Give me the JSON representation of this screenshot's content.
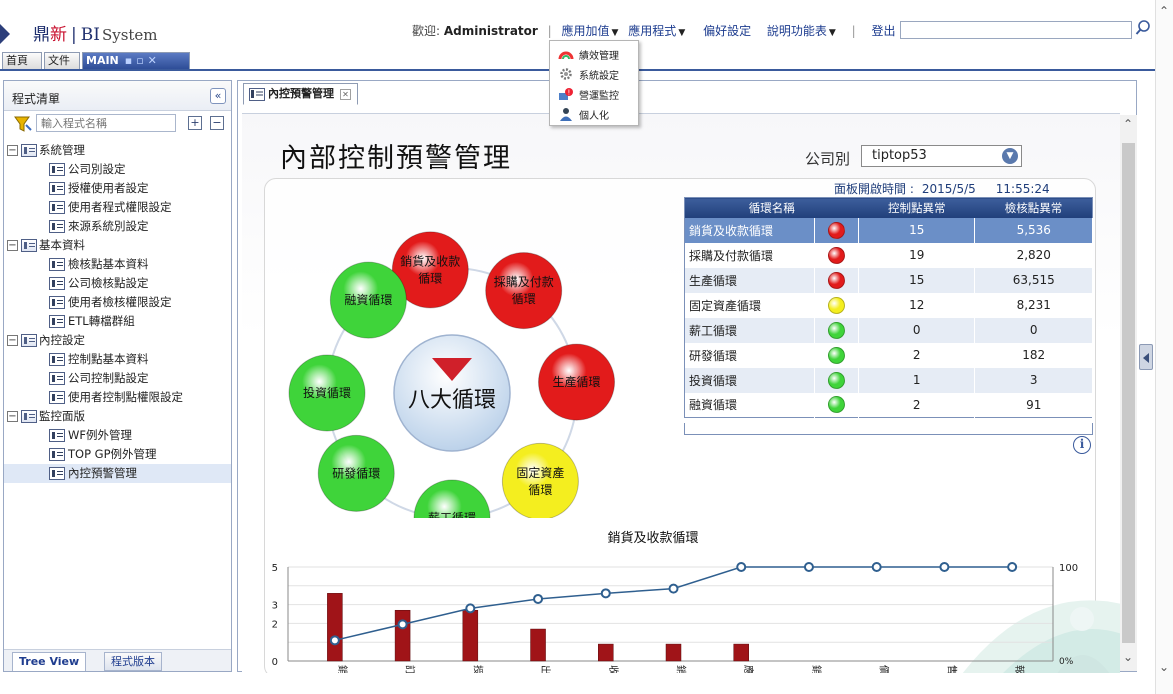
{
  "logo": {
    "part1": "鼎",
    "part2": "新",
    "bar": "|",
    "part3": "BI",
    "part4": "System"
  },
  "topnav": {
    "welcome": "歡迎:",
    "user": "Administrator",
    "sep1": "|",
    "app_addon": "應用加值",
    "app_program": "應用程式",
    "preferences": "偏好設定",
    "help_menu": "說明功能表",
    "sep2": "|",
    "logout": "登出"
  },
  "app_menu": {
    "items": [
      {
        "label": "績效管理",
        "icon": "gauge-icon"
      },
      {
        "label": "系統設定",
        "icon": "gear-icon"
      },
      {
        "label": "營運監控",
        "icon": "monitor-icon"
      },
      {
        "label": "個人化",
        "icon": "user-icon"
      }
    ]
  },
  "tabs": [
    {
      "label": "首頁"
    },
    {
      "label": "文件"
    },
    {
      "label": "MAIN"
    }
  ],
  "left_panel": {
    "title": "程式清單",
    "collapse": "«",
    "search_placeholder": "輸入程式名稱",
    "expand_all": "+",
    "collapse_all": "−",
    "tree": [
      {
        "label": "系統管理",
        "level": 0,
        "folder": true
      },
      {
        "label": "公司別設定",
        "level": 1
      },
      {
        "label": "授權使用者設定",
        "level": 1
      },
      {
        "label": "使用者程式權限設定",
        "level": 1
      },
      {
        "label": "來源系統別設定",
        "level": 1
      },
      {
        "label": "基本資料",
        "level": 0,
        "folder": true
      },
      {
        "label": "檢核點基本資料",
        "level": 1
      },
      {
        "label": "公司檢核點設定",
        "level": 1
      },
      {
        "label": "使用者檢核權限設定",
        "level": 1
      },
      {
        "label": "ETL轉檔群組",
        "level": 1
      },
      {
        "label": "內控設定",
        "level": 0,
        "folder": true
      },
      {
        "label": "控制點基本資料",
        "level": 1
      },
      {
        "label": "公司控制點設定",
        "level": 1
      },
      {
        "label": "使用者控制點權限設定",
        "level": 1
      },
      {
        "label": "監控面版",
        "level": 0,
        "folder": true
      },
      {
        "label": "WF例外管理",
        "level": 1
      },
      {
        "label": "TOP GP例外管理",
        "level": 1
      },
      {
        "label": "內控預警管理",
        "level": 1,
        "selected": true
      }
    ],
    "footer_tabs": [
      "Tree View",
      "程式版本"
    ]
  },
  "main": {
    "tab_label": "內控預警管理",
    "tab_close": "✕",
    "page_title": "內部控制預警管理",
    "company_label": "公司別",
    "company_value": "tiptop53",
    "open_time_label": "面板開啟時間 :",
    "open_date": "2015/5/5",
    "open_time": "11:55:24",
    "info": "i",
    "diagram": {
      "center": "八大循環",
      "nodes": [
        {
          "label": "銷貨及收款\n循環",
          "status": "red"
        },
        {
          "label": "採購及付款\n循環",
          "status": "red"
        },
        {
          "label": "生產循環",
          "status": "red"
        },
        {
          "label": "固定資產\n循環",
          "status": "yellow"
        },
        {
          "label": "薪工循環",
          "status": "green"
        },
        {
          "label": "研發循環",
          "status": "green"
        },
        {
          "label": "投資循環",
          "status": "green"
        },
        {
          "label": "融資循環",
          "status": "green"
        }
      ]
    },
    "table": {
      "headers": [
        "循環名稱",
        "控制點異常",
        "檢核點異常"
      ],
      "rows": [
        {
          "name": "銷貨及收款循環",
          "status": "red",
          "control": "15",
          "check": "5,536",
          "selected": true
        },
        {
          "name": "採購及付款循環",
          "status": "red",
          "control": "19",
          "check": "2,820"
        },
        {
          "name": "生產循環",
          "status": "red",
          "control": "15",
          "check": "63,515"
        },
        {
          "name": "固定資產循環",
          "status": "yellow",
          "control": "12",
          "check": "8,231"
        },
        {
          "name": "薪工循環",
          "status": "green",
          "control": "0",
          "check": "0"
        },
        {
          "name": "研發循環",
          "status": "green",
          "control": "2",
          "check": "182"
        },
        {
          "name": "投資循環",
          "status": "green",
          "control": "1",
          "check": "3"
        },
        {
          "name": "融資循環",
          "status": "green",
          "control": "2",
          "check": "91"
        }
      ]
    }
  },
  "colors": {
    "red": "#e21b1b",
    "yellow": "#f4ee1f",
    "green": "#3fd43a",
    "bar": "#a01418",
    "line": "#2f5f8f",
    "accent": "#2e4d97"
  },
  "chart_data": {
    "type": "bar",
    "title": "銷貨及收款循環",
    "categories": [
      "銷貨退回/折讓",
      "訂單處理",
      "授信管理",
      "出貨作業",
      "收款作業",
      "銷售預測/計畫",
      "應收帳款",
      "銷售毛利分析",
      "價格管理",
      "售後服務",
      "報價作業"
    ],
    "values": [
      3.6,
      2.7,
      2.7,
      1.7,
      0.9,
      0.9,
      0.9,
      0,
      0,
      0,
      0
    ],
    "ylim": [
      0,
      5
    ],
    "yticks": [
      0,
      2,
      3,
      5
    ],
    "cumulative_pct": [
      0.22,
      0.39,
      0.56,
      0.66,
      0.72,
      0.77,
      1.0,
      1.0,
      1.0,
      1.0,
      1.0
    ],
    "y2ticks": [
      "0%",
      "100%"
    ]
  }
}
